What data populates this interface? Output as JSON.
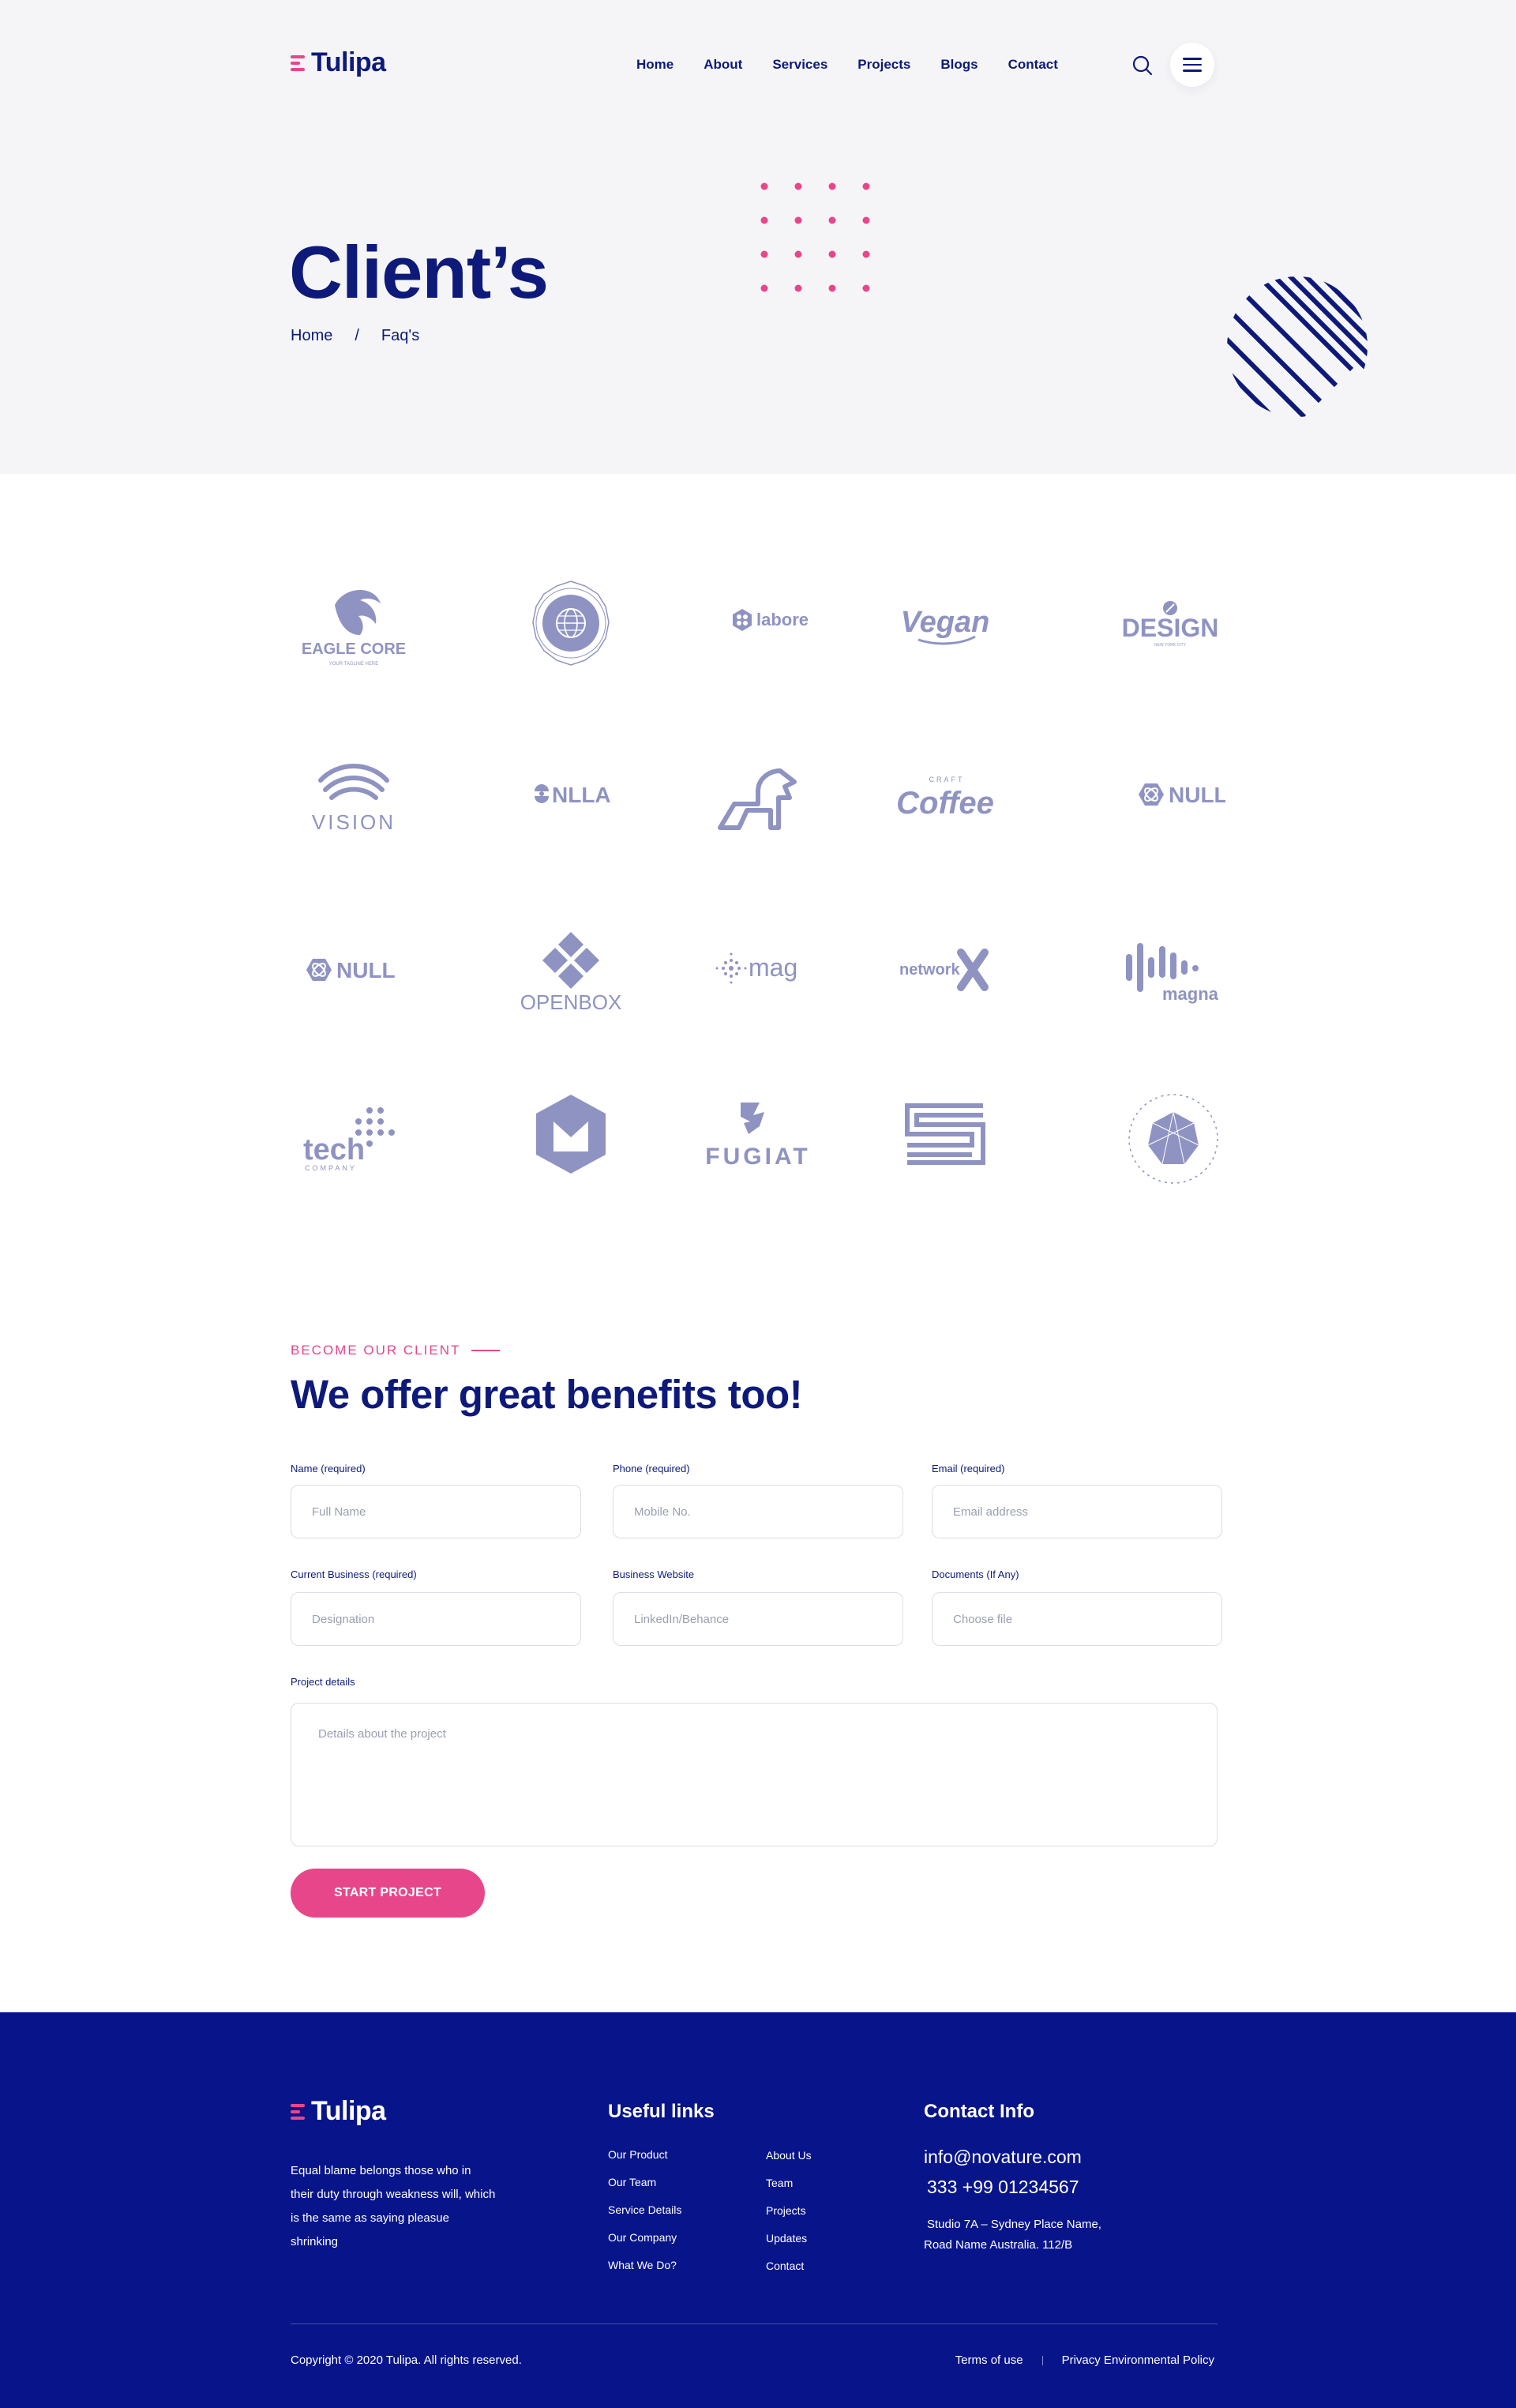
{
  "header": {
    "logo_text": "Tulipa",
    "nav": [
      "Home",
      "About",
      "Services",
      "Projects",
      "Blogs",
      "Contact"
    ],
    "icons": [
      "search-icon",
      "hamburger-menu-icon"
    ]
  },
  "hero": {
    "title": "Client’s",
    "breadcrumb": [
      "Home",
      "/",
      "Faq's"
    ]
  },
  "clients": {
    "logos": [
      "EAGLE CORE",
      "globe-seal",
      "labore",
      "Vegan",
      "DESIGN",
      "VISION",
      "NLLA",
      "lion-mark",
      "Coffee",
      "NULL",
      "NULL",
      "OPENBOX",
      "mag",
      "network",
      "magna",
      "tech",
      "M-hexagon",
      "FUGIAT",
      "S-maze",
      "polygon-seal"
    ],
    "eagle_tagline": "YOUR TAGLINE HERE",
    "design_tagline": "NEW YORK CITY",
    "coffee_tagline": "CRAFT",
    "tech_tagline": "COMPANY"
  },
  "form": {
    "eyebrow": "BECOME OUR CLIENT",
    "title": "We offer great benefits too!",
    "fields": [
      {
        "label": "Name (required)",
        "placeholder": "Full Name"
      },
      {
        "label": "Phone (required)",
        "placeholder": "Mobile No."
      },
      {
        "label": "Email (required)",
        "placeholder": "Email address"
      },
      {
        "label": "Current Business (required)",
        "placeholder": "Designation"
      },
      {
        "label": "Business Website",
        "placeholder": "LinkedIn/Behance"
      },
      {
        "label": "Documents (If Any)",
        "placeholder": "Choose file"
      }
    ],
    "details_label": "Project details",
    "details_placeholder": "Details about the project",
    "submit_label": "START PROJECT"
  },
  "footer": {
    "logo_text": "Tulipa",
    "about": "Equal blame belongs those who in their duty through weakness will, which is the same as saying pleasue shrinking",
    "useful_links_heading": "Useful links",
    "links_col1": [
      "Our Product",
      "Our Team",
      "Service Details",
      "Our Company",
      "What We Do?"
    ],
    "links_col2": [
      "About Us",
      "Team",
      "Projects",
      "Updates",
      "Contact"
    ],
    "contact_heading": "Contact Info",
    "email": "info@novature.com",
    "phone": "333 +99 01234567",
    "address_line1": "Studio 7A – Sydney Place Name,",
    "address_line2": "Road Name Australia. 112/B",
    "copyright": "Copyright © 2020 Tulipa. All rights reserved.",
    "legal": [
      "Terms of use",
      "Privacy Environmental Policy"
    ]
  },
  "colors": {
    "primary": "#0d1a7a",
    "accent": "#e8468a",
    "footer_bg": "#08158a",
    "hero_bg": "#f5f5f7",
    "logo_grey": "#8f93c2"
  }
}
